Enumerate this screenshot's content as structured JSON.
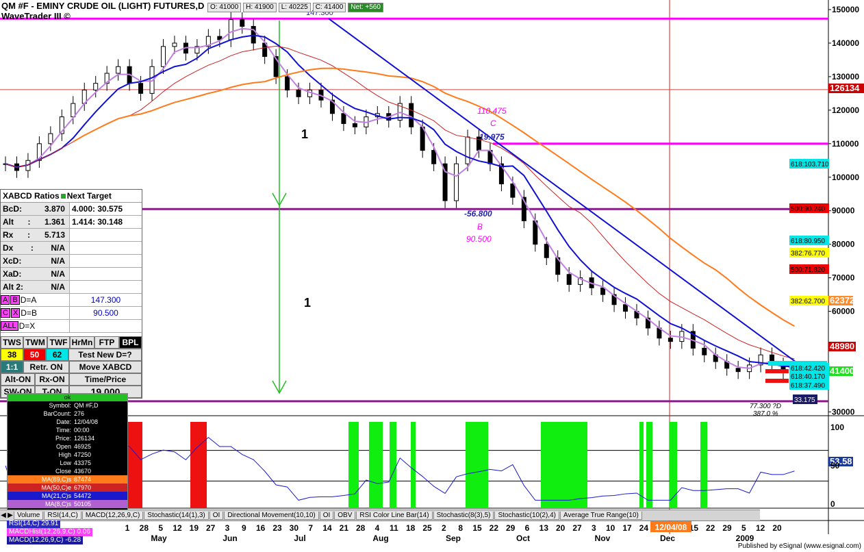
{
  "window": {
    "title": "QM #F - EMINY CRUDE OIL (LIGHT) FUTURES,D",
    "subtitle": "WaveTrader III ©"
  },
  "ohlc": {
    "open": "O: 41000",
    "high": "H: 41900",
    "low": "L: 40225",
    "close": "C: 41400",
    "net": "Net: +560"
  },
  "colors": {
    "magenta": "#ff00ff",
    "blue_ma": "#1010d0",
    "orange_ma": "#ff7a1a",
    "red_ma": "#cc2222",
    "lavender_ma": "#c080e0",
    "green_zone": "#10ee10",
    "red_zone": "#ee1111",
    "purple_line": "#8a1a8a"
  },
  "chart_data": {
    "type": "candlestick",
    "y_axis_ticks": [
      "150000",
      "140000",
      "130000",
      "120000",
      "110000",
      "100000",
      "90000",
      "80000",
      "70000",
      "60000",
      "30000"
    ],
    "x_axis_days": [
      "1",
      "28",
      "5",
      "12",
      "19",
      "27",
      "3",
      "9",
      "16",
      "23",
      "30",
      "7",
      "14",
      "21",
      "28",
      "4",
      "11",
      "18",
      "25",
      "2",
      "8",
      "15",
      "22",
      "29",
      "6",
      "13",
      "20",
      "27",
      "3",
      "10",
      "17",
      "24",
      "1",
      "8",
      "15",
      "22",
      "29",
      "5",
      "12",
      "20"
    ],
    "x_axis_months": [
      "May",
      "Jun",
      "Jul",
      "Aug",
      "Sep",
      "Oct",
      "Nov",
      "Dec",
      "2009"
    ],
    "price_labels": [
      {
        "text": "126134",
        "bg": "#cc0000",
        "fg": "#ffffff"
      },
      {
        "text": "618:103.710",
        "bg": "#00e5e5",
        "fg": "#000000"
      },
      {
        "text": "500:90.240",
        "bg": "#ee0000",
        "fg": "#000000"
      },
      {
        "text": "618:80.950",
        "bg": "#00e5e5",
        "fg": "#000000"
      },
      {
        "text": "382:76.770",
        "bg": "#ffff00",
        "fg": "#000000"
      },
      {
        "text": "500:71.820",
        "bg": "#ee0000",
        "fg": "#000000"
      },
      {
        "text": "382:62.700",
        "bg": "#ffff00",
        "fg": "#000000"
      },
      {
        "text": "62372",
        "bg": "#ff8a2a",
        "fg": "#ffffff"
      },
      {
        "text": "48980",
        "bg": "#cc0000",
        "fg": "#ffffff"
      },
      {
        "text": "41400",
        "bg": "#22dd22",
        "fg": "#ffffff"
      },
      {
        "text": "618:42.420",
        "bg": "#00e5e5",
        "fg": "#000000"
      },
      {
        "text": "618:40.170",
        "bg": "#00e5e5",
        "fg": "#000000"
      },
      {
        "text": "618:37.490",
        "bg": "#00e5e5",
        "fg": "#000000"
      },
      {
        "text": "33.175",
        "bg": "#1a1a66",
        "fg": "#ffffff"
      },
      {
        "text": "53.58",
        "bg": "#1a3a9a",
        "fg": "#ffffff"
      }
    ],
    "annotations": [
      "147.300",
      "110.475",
      "C",
      "19.975",
      "-56.800",
      "B",
      "90.500",
      "1",
      "1",
      "77.300 ?D",
      "387.0 %"
    ],
    "oscillator_ticks": [
      "100",
      "50",
      "0"
    ],
    "selected_date": "12/04/08",
    "close_series": [
      104,
      102,
      105,
      110,
      113,
      118,
      122,
      126,
      128,
      131,
      133,
      128,
      125,
      133,
      139,
      140,
      137,
      139,
      142,
      141,
      147,
      145,
      140,
      136,
      130,
      126,
      124,
      126,
      123,
      119,
      116,
      115,
      118,
      119,
      117,
      122,
      115,
      108,
      104,
      93,
      104,
      112,
      108,
      104,
      98,
      94,
      87,
      80,
      76,
      71,
      68,
      70,
      67,
      65,
      62,
      60,
      58,
      55,
      52,
      51,
      54,
      49,
      47,
      45,
      43,
      42,
      44,
      47,
      44,
      42,
      41.4
    ]
  },
  "xabcd": {
    "header": "XABCD Ratios",
    "next_target": "Next Target",
    "rows": [
      {
        "label": "BcD:",
        "val1": "3.870",
        "val2": "4.000: 30.575"
      },
      {
        "label": "Alt",
        "colon": ":",
        "val1": "1.361",
        "val2": "1.414: 30.148"
      },
      {
        "label": "Rx",
        "colon": ":",
        "val1": "5.713",
        "val2": ""
      },
      {
        "label": "Dx",
        "colon": ":",
        "val1": "N/A",
        "val2": ""
      },
      {
        "label": "XcD:",
        "val1": "N/A",
        "val2": ""
      },
      {
        "label": "XaD:",
        "val1": "N/A",
        "val2": ""
      },
      {
        "label": "Alt 2:",
        "val1": "N/A",
        "val2": ""
      }
    ],
    "ab": {
      "k1": "A",
      "k2": "B",
      "eq": "D=A",
      "val": "147.300"
    },
    "cx": {
      "k1": "C",
      "k2": "X",
      "eq": "D=B",
      "val": "90.500"
    },
    "all": {
      "k1": "ALL",
      "eq": "D=X",
      "val": ""
    }
  },
  "buttons": {
    "row1": [
      "TWS",
      "TWM",
      "TWF",
      "HrMn",
      "FTP",
      "BPL"
    ],
    "row2": [
      "38",
      "50",
      "62",
      "Test New D=?"
    ],
    "row3": [
      "1:1",
      "Retr. ON",
      "Move XABCD"
    ],
    "row4": [
      "Alt-ON",
      "Rx-ON",
      "Time/Price"
    ],
    "row5": [
      "SW-ON",
      "T-ON",
      "19.000"
    ]
  },
  "info": {
    "ok": "ok",
    "rows": [
      {
        "k": "Symbol:",
        "v": "QM #F,D"
      },
      {
        "k": "BarCount:",
        "v": "276"
      },
      {
        "k": "Date:",
        "v": "12/04/08"
      },
      {
        "k": "Time:",
        "v": "00:00"
      },
      {
        "k": "Price:",
        "v": "126134"
      },
      {
        "k": "Open",
        "v": "46925"
      },
      {
        "k": "High",
        "v": "47250"
      },
      {
        "k": "Low",
        "v": "43375"
      },
      {
        "k": "Close",
        "v": "43670"
      },
      {
        "k": "MA(89,C)s",
        "v": "87474",
        "bg": "#ff7a1a"
      },
      {
        "k": "MA(50,C)e",
        "v": "67970",
        "bg": "#cc2222"
      },
      {
        "k": "MA(21,C)s",
        "v": "54472",
        "bg": "#1a1acc"
      },
      {
        "k": "MA(8,C)s",
        "v": "50105",
        "bg": "#b060d0"
      }
    ]
  },
  "bottom_legend": [
    {
      "text": "RSI(14,C) 29.91",
      "bg": "#2a2ac0",
      "fg": "#ffffff"
    },
    {
      "text": "MACDHist(12,26,9,C) 0.06",
      "bg": "#ff40ff",
      "fg": "#ffffff"
    },
    {
      "text": "MACD(12,26,9,C) -6.28",
      "bg": "#1a1aa0",
      "fg": "#ffffff"
    }
  ],
  "tabs": [
    "Volume",
    "RSI(14,C)",
    "MACD(12,26,9,C)",
    "Stochastic(14(1),3)",
    "OI",
    "Directional Movement(10,10)",
    "OI",
    "OBV",
    "RSI Color Line Bar(14)",
    "Stochastic(8(3),5)",
    "Stochastic(10(2),4)",
    "Average True Range(10)"
  ],
  "footer": "Published by eSignal (www.esignal.com)"
}
